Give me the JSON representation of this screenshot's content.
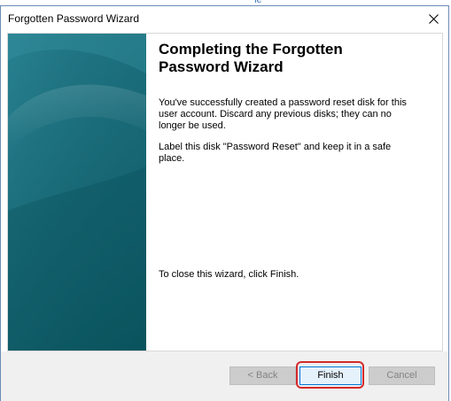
{
  "background": {
    "partial_text": "fe "
  },
  "window": {
    "title": "Forgotten Password Wizard"
  },
  "content": {
    "heading": "Completing the Forgotten Password Wizard",
    "paragraph1": "You've successfully created a password reset disk for this user account. Discard any previous disks; they can no longer be used.",
    "paragraph2": "Label this disk \"Password Reset\" and keep it in a safe place.",
    "paragraph3": "To close this wizard, click Finish."
  },
  "buttons": {
    "back": "< Back",
    "finish": "Finish",
    "cancel": "Cancel"
  },
  "colors": {
    "side_panel": "#12606e",
    "highlight": "#d42a2a",
    "accent": "#0078d7"
  },
  "icons": {
    "close": "close-icon"
  }
}
